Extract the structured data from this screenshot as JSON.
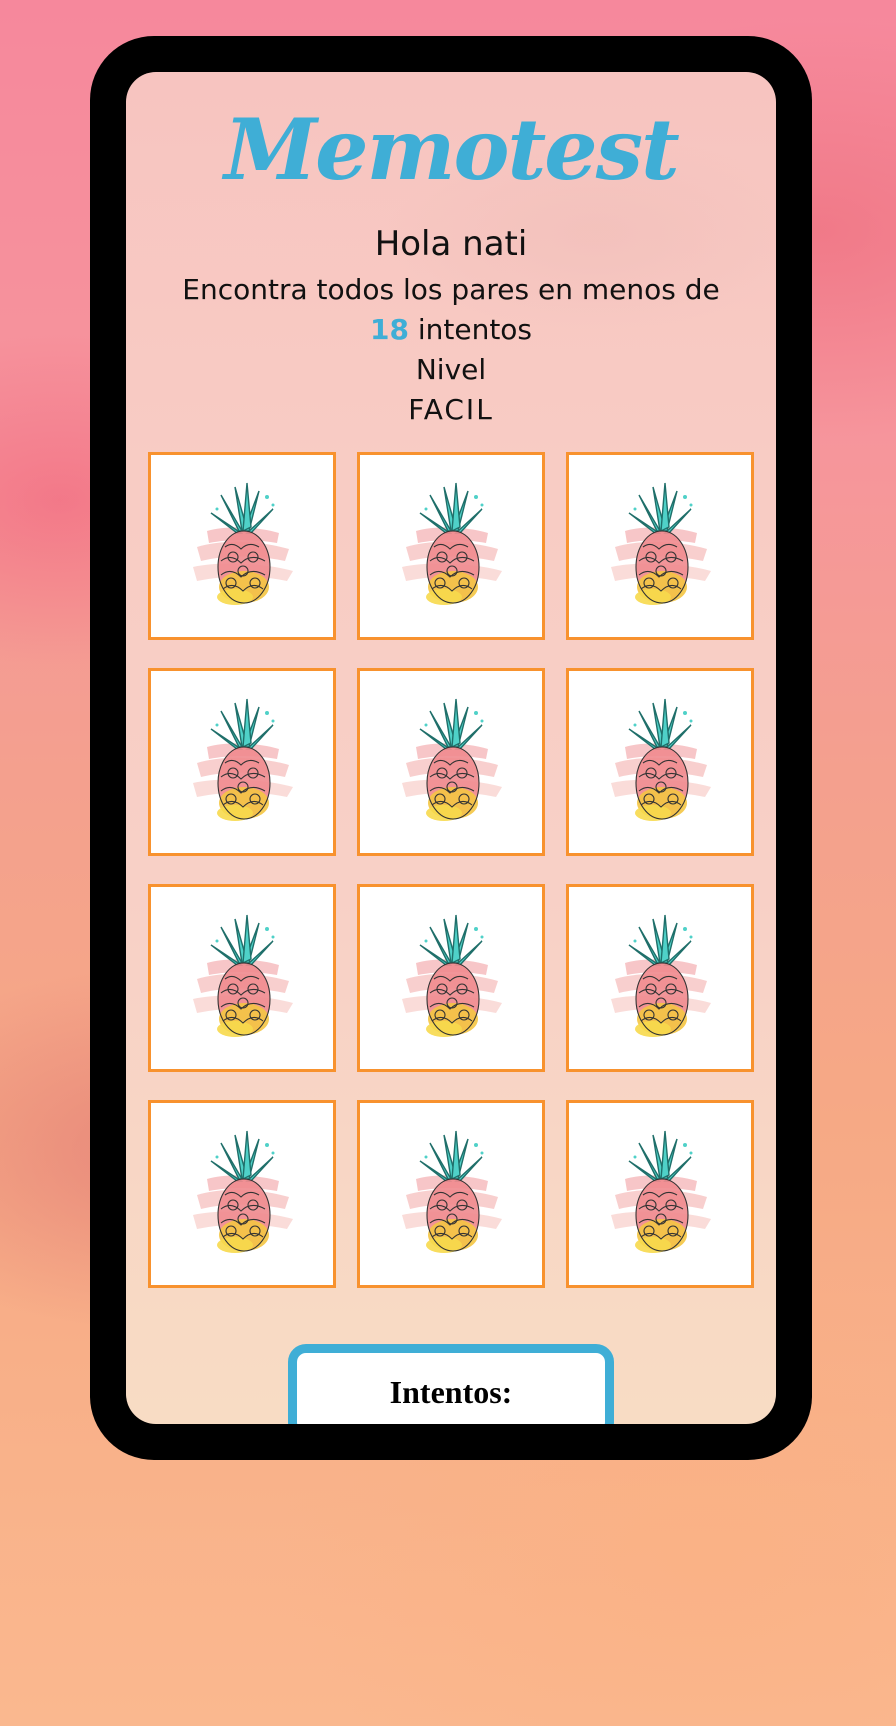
{
  "game": {
    "title": "Memotest",
    "greeting": "Hola nati",
    "instructions_prefix": "Encontra todos los pares en menos de ",
    "max_attempts": "18",
    "instructions_suffix": " intentos",
    "level_label": "Nivel",
    "level_value": "FACIL",
    "attempts_label": "Intentos:"
  },
  "board": {
    "rows": 4,
    "columns": 3,
    "card_back": "pineapple-illustration",
    "card_border_color": "#f8922e"
  },
  "colors": {
    "accent": "#3faed6",
    "card_border": "#f8922e",
    "phone_frame": "#000000"
  }
}
